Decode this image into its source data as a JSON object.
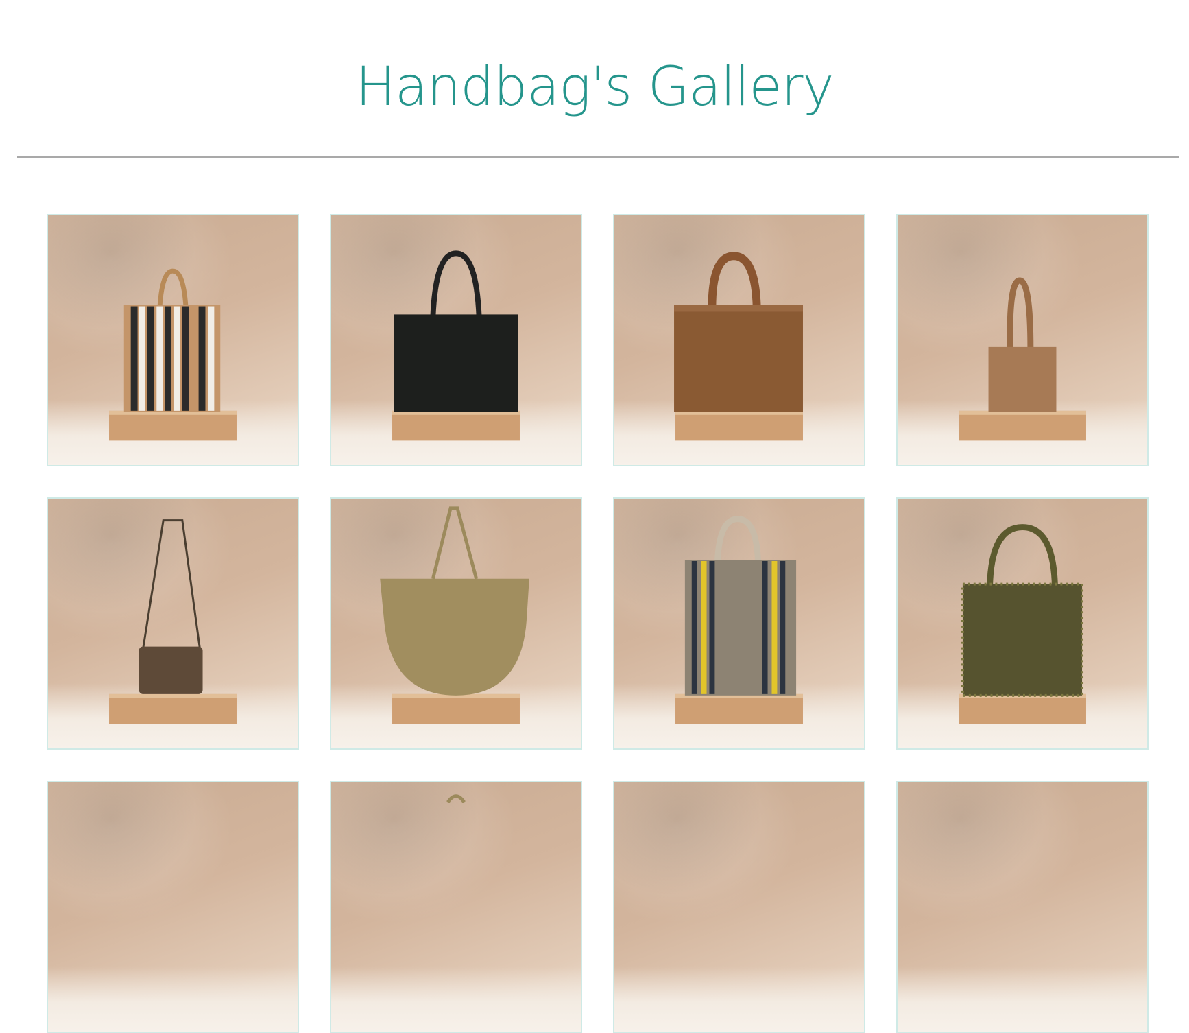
{
  "page": {
    "title": "Handbag's Gallery"
  },
  "colors": {
    "title": "#25958c",
    "divider": "#a9a9a9",
    "card_border": "#cfeae6",
    "backdrop": "#d3b59d",
    "plinth": "#cf9f73"
  },
  "gallery": {
    "items": [
      {
        "name": "striped-jute-tote-black-natural",
        "icon": "handbag-image"
      },
      {
        "name": "black-raffia-tote",
        "icon": "handbag-image"
      },
      {
        "name": "brown-woven-tote",
        "icon": "handbag-image"
      },
      {
        "name": "small-tan-tote",
        "icon": "handbag-image"
      },
      {
        "name": "crossbody-woven-pouch",
        "icon": "handbag-image"
      },
      {
        "name": "olive-raffia-bucket-bag",
        "icon": "handbag-image"
      },
      {
        "name": "grey-tote-yellow-navy-stripes",
        "icon": "handbag-image"
      },
      {
        "name": "olive-crochet-tote",
        "icon": "handbag-image"
      },
      {
        "name": "partial-item-9",
        "icon": "handbag-image"
      },
      {
        "name": "partial-item-10",
        "icon": "handbag-image"
      },
      {
        "name": "partial-item-11",
        "icon": "handbag-image"
      },
      {
        "name": "partial-item-12",
        "icon": "handbag-image"
      }
    ]
  }
}
